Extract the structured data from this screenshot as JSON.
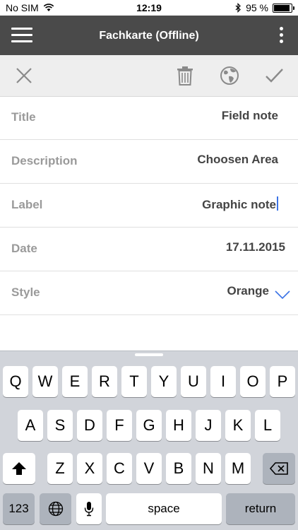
{
  "status": {
    "carrier": "No SIM",
    "time": "12:19",
    "battery": "95 %",
    "battery_level": 0.95
  },
  "header": {
    "title": "Fachkarte (Offline)"
  },
  "toolbar": {
    "close_icon": "close-icon",
    "delete_icon": "trash-icon",
    "globe_icon": "globe-icon",
    "confirm_icon": "checkmark-icon"
  },
  "form": {
    "rows": [
      {
        "label": "Title",
        "value": "Field note"
      },
      {
        "label": "Description",
        "value": "Choosen Area"
      },
      {
        "label": "Label",
        "value": "Graphic note"
      },
      {
        "label": "Date",
        "value": "17.11.2015"
      },
      {
        "label": "Style",
        "value": "Orange"
      }
    ]
  },
  "keyboard": {
    "row1": [
      "Q",
      "W",
      "E",
      "R",
      "T",
      "Y",
      "U",
      "I",
      "O",
      "P"
    ],
    "row2": [
      "A",
      "S",
      "D",
      "F",
      "G",
      "H",
      "J",
      "K",
      "L"
    ],
    "row3": [
      "Z",
      "X",
      "C",
      "V",
      "B",
      "N",
      "M"
    ],
    "numbers_label": "123",
    "space_label": "space",
    "return_label": "return"
  },
  "colors": {
    "header_bg": "#4a4a4a",
    "toolbar_bg": "#eeeeee",
    "accent": "#3b73e6",
    "keyboard_bg": "#d1d4da"
  }
}
